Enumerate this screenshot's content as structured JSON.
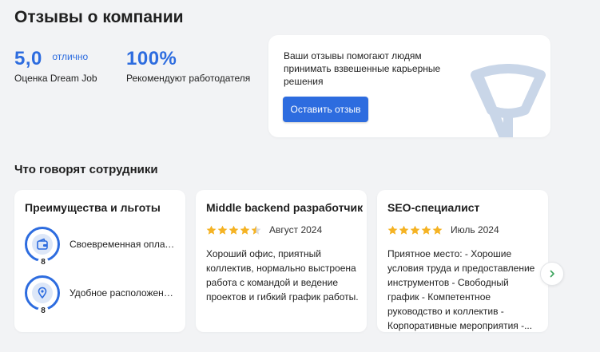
{
  "page": {
    "title": "Отзывы о компании"
  },
  "stats": {
    "rating": {
      "value": "5,0",
      "quality": "отлично",
      "caption": "Оценка Dream Job"
    },
    "recommend": {
      "value": "100%",
      "caption": "Рекомендуют работодателя"
    }
  },
  "promo": {
    "text": "Ваши отзывы помогают людям принимать взвешенные карьерные решения",
    "button_label": "Оставить отзыв",
    "logo_icon": "dreamjob-logo-icon"
  },
  "section": {
    "title": "Что говорят сотрудники"
  },
  "benefits_card": {
    "title": "Преимущества и льготы",
    "items": [
      {
        "icon": "wallet-icon",
        "count": "8",
        "label": "Своевременная оплата труда"
      },
      {
        "icon": "location-pin-icon",
        "count": "8",
        "label": "Удобное расположение офиса"
      }
    ]
  },
  "reviews": [
    {
      "title": "Middle backend разработчик",
      "rating": 4.5,
      "date": "Август 2024",
      "text": "Хороший офис, приятный коллектив, нормально выстроена работа с командой и ведение проектов и гибкий график работы."
    },
    {
      "title": "SEO-специалист",
      "rating": 5,
      "date": "Июль 2024",
      "text": "Приятное место: - Хорошие условия труда и предоставление инструментов - Свободный график - Компетентное руководство и коллектив - Корпоративные мероприятия -..."
    }
  ],
  "carousel": {
    "next_icon": "chevron-right-icon"
  },
  "colors": {
    "accent": "#2d6cdf",
    "star": "#f5b324",
    "background": "#f2f3f5",
    "logo": "#c9d6e8",
    "next_chevron": "#3aa35b"
  }
}
